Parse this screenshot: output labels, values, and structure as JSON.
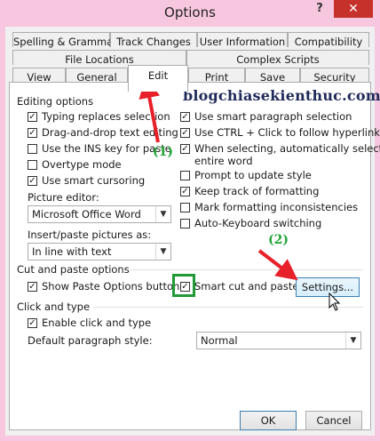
{
  "window": {
    "title": "Options",
    "help": "?",
    "close": "✕"
  },
  "tabs": {
    "row1": [
      "Spelling & Grammar",
      "Track Changes",
      "User Information",
      "Compatibility"
    ],
    "row2": [
      "File Locations",
      "Complex Scripts"
    ],
    "row3": [
      "View",
      "General",
      "Edit",
      "Print",
      "Save",
      "Security"
    ],
    "active": "Edit"
  },
  "editing": {
    "heading": "Editing options",
    "left": [
      {
        "label": "Typing replaces selection",
        "checked": true
      },
      {
        "label": "Drag-and-drop text editing",
        "checked": true
      },
      {
        "label": "Use the INS key for paste",
        "checked": false
      },
      {
        "label": "Overtype mode",
        "checked": false
      },
      {
        "label": "Use smart cursoring",
        "checked": true
      }
    ],
    "right": [
      {
        "label": "Use smart paragraph selection",
        "checked": true
      },
      {
        "label": "Use CTRL + Click to follow hyperlink",
        "checked": true
      },
      {
        "label": "When selecting, automatically select",
        "label2": "entire word",
        "checked": true
      },
      {
        "label": "Prompt to update style",
        "checked": false
      },
      {
        "label": "Keep track of formatting",
        "checked": true
      },
      {
        "label": "Mark formatting inconsistencies",
        "checked": false
      },
      {
        "label": "Auto-Keyboard switching",
        "checked": false
      }
    ],
    "picture_editor_label": "Picture editor:",
    "picture_editor_value": "Microsoft Office Word",
    "insert_paste_label": "Insert/paste pictures as:",
    "insert_paste_value": "In line with text"
  },
  "cutpaste": {
    "heading": "Cut and paste options",
    "show_paste": {
      "label": "Show Paste Options buttons",
      "checked": true
    },
    "smart_cut": {
      "label": "Smart cut and paste",
      "checked": true
    },
    "settings_button": "Settings..."
  },
  "click_type": {
    "heading": "Click and type",
    "enable": {
      "label": "Enable click and type",
      "checked": true
    },
    "default_style_label": "Default paragraph style:",
    "default_style_value": "Normal"
  },
  "footer": {
    "ok": "OK",
    "cancel": "Cancel"
  },
  "annotations": {
    "step1": "(1)",
    "step2": "(2)",
    "watermark": "blogchiasekienthuc.com"
  },
  "colors": {
    "annotation_arrow": "#e8202a",
    "annotation_text": "#22a639",
    "highlight_box": "#1f9a36"
  }
}
